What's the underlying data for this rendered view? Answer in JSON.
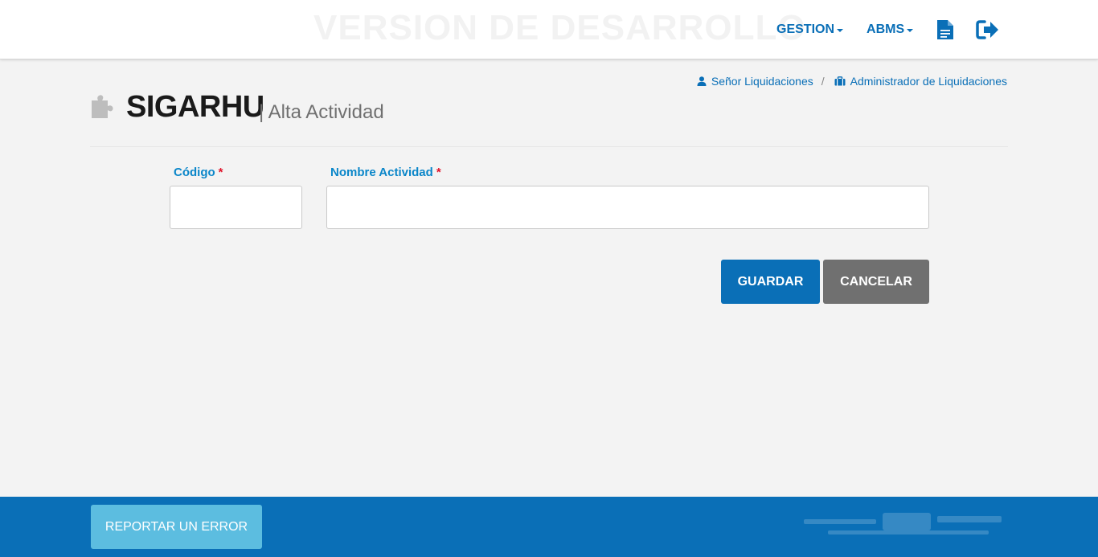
{
  "header": {
    "watermark": "VERSION DE DESARROLLO",
    "menu": {
      "gestion_label": "GESTION",
      "abms_label": "ABMS"
    },
    "icons": [
      "document-icon",
      "logout-icon"
    ]
  },
  "userline": {
    "user_name": "Señor Liquidaciones",
    "separator": "/",
    "role": "Administrador de Liquidaciones"
  },
  "page": {
    "app_title": "SIGARHU",
    "subtitle": "| Alta Actividad"
  },
  "form": {
    "codigo": {
      "label": "Código",
      "required_mark": "*",
      "value": ""
    },
    "nombre_actividad": {
      "label": "Nombre Actividad",
      "required_mark": "*",
      "value": ""
    },
    "save_label": "GUARDAR",
    "cancel_label": "CANCELAR"
  },
  "footer": {
    "report_label": "REPORTAR UN ERROR"
  },
  "colors": {
    "primary": "#0a6fb7",
    "label_blue": "#0a86c9",
    "required_red": "#e0142b",
    "cancel_gray": "#707070",
    "report_light_blue": "#5cbde0",
    "background": "#f3f3f3"
  }
}
